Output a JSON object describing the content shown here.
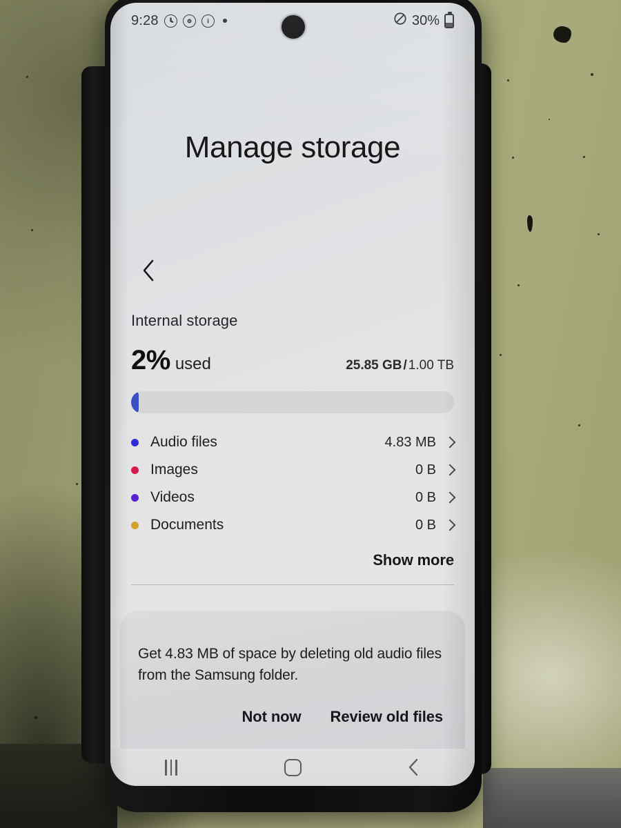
{
  "status_bar": {
    "time": "9:28",
    "icons": [
      "alarm-icon",
      "do-not-disturb-circle-icon",
      "info-circle-icon",
      "status-dot-icon"
    ],
    "mute_icon": "no-symbol-icon",
    "battery_percent": "30%"
  },
  "header": {
    "title": "Manage storage",
    "back_icon": "chevron-left-icon"
  },
  "storage": {
    "section_label": "Internal storage",
    "percent_value": "2%",
    "percent_word": "used",
    "used": "25.85 GB",
    "separator": "/",
    "total": "1.00 TB",
    "progress_percent": 2,
    "progress_color": "#3a4fc4",
    "track_color": "#d6d6d9"
  },
  "categories": [
    {
      "label": "Audio files",
      "size": "4.83 MB",
      "color": "#2b2bd8"
    },
    {
      "label": "Images",
      "size": "0 B",
      "color": "#d81b48"
    },
    {
      "label": "Videos",
      "size": "0 B",
      "color": "#5b1fd8"
    },
    {
      "label": "Documents",
      "size": "0 B",
      "color": "#d1a22a"
    }
  ],
  "show_more": {
    "label": "Show more"
  },
  "suggestion": {
    "text": "Get 4.83 MB of space by deleting old audio files from the Samsung folder.",
    "dismiss_label": "Not now",
    "primary_label": "Review old files"
  },
  "nav_bar": {
    "recents_icon": "recents-icon",
    "home_icon": "home-icon",
    "back_icon": "back-icon"
  }
}
